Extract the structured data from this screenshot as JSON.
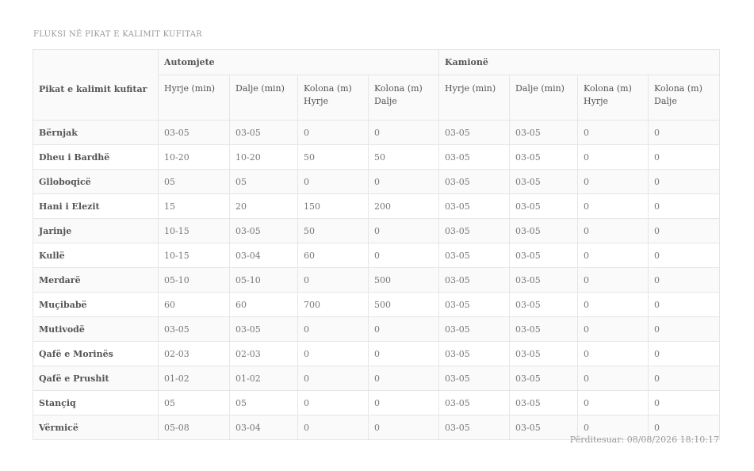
{
  "page_title": "FLUKSI NË PIKAT E KALIMIT KUFITAR",
  "table": {
    "first_header": "Pikat e kalimit kufitar",
    "groups": [
      "Automjete",
      "Kamionë"
    ],
    "sub_headers": [
      "Hyrje (min)",
      "Dalje (min)",
      "Kolona (m) Hyrje",
      "Kolona (m) Dalje",
      "Hyrje (min)",
      "Dalje (min)",
      "Kolona (m) Hyrje",
      "Kolona (m) Dalje"
    ],
    "rows": [
      [
        "Bërnjak",
        "03-05",
        "03-05",
        "0",
        "0",
        "03-05",
        "03-05",
        "0",
        "0"
      ],
      [
        "Dheu i Bardhë",
        "10-20",
        "10-20",
        "50",
        "50",
        "03-05",
        "03-05",
        "0",
        "0"
      ],
      [
        "Glloboqicë",
        "05",
        "05",
        "0",
        "0",
        "03-05",
        "03-05",
        "0",
        "0"
      ],
      [
        "Hani i Elezit",
        "15",
        "20",
        "150",
        "200",
        "03-05",
        "03-05",
        "0",
        "0"
      ],
      [
        "Jarinje",
        "10-15",
        "03-05",
        "50",
        "0",
        "03-05",
        "03-05",
        "0",
        "0"
      ],
      [
        "Kullë",
        "10-15",
        "03-04",
        "60",
        "0",
        "03-05",
        "03-05",
        "0",
        "0"
      ],
      [
        "Merdarë",
        "05-10",
        "05-10",
        "0",
        "500",
        "03-05",
        "03-05",
        "0",
        "0"
      ],
      [
        "Muçibabë",
        "60",
        "60",
        "700",
        "500",
        "03-05",
        "03-05",
        "0",
        "0"
      ],
      [
        "Mutivodë",
        "03-05",
        "03-05",
        "0",
        "0",
        "03-05",
        "03-05",
        "0",
        "0"
      ],
      [
        "Qafë e Morinës",
        "02-03",
        "02-03",
        "0",
        "0",
        "03-05",
        "03-05",
        "0",
        "0"
      ],
      [
        "Qafë e Prushit",
        "01-02",
        "01-02",
        "0",
        "0",
        "03-05",
        "03-05",
        "0",
        "0"
      ],
      [
        "Stançiq",
        "05",
        "05",
        "0",
        "0",
        "03-05",
        "03-05",
        "0",
        "0"
      ],
      [
        "Vërmicë",
        "05-08",
        "03-04",
        "0",
        "0",
        "03-05",
        "03-05",
        "0",
        "0"
      ]
    ]
  },
  "updated_text": "Përditesuar: 08/08/2026 18:10:17"
}
